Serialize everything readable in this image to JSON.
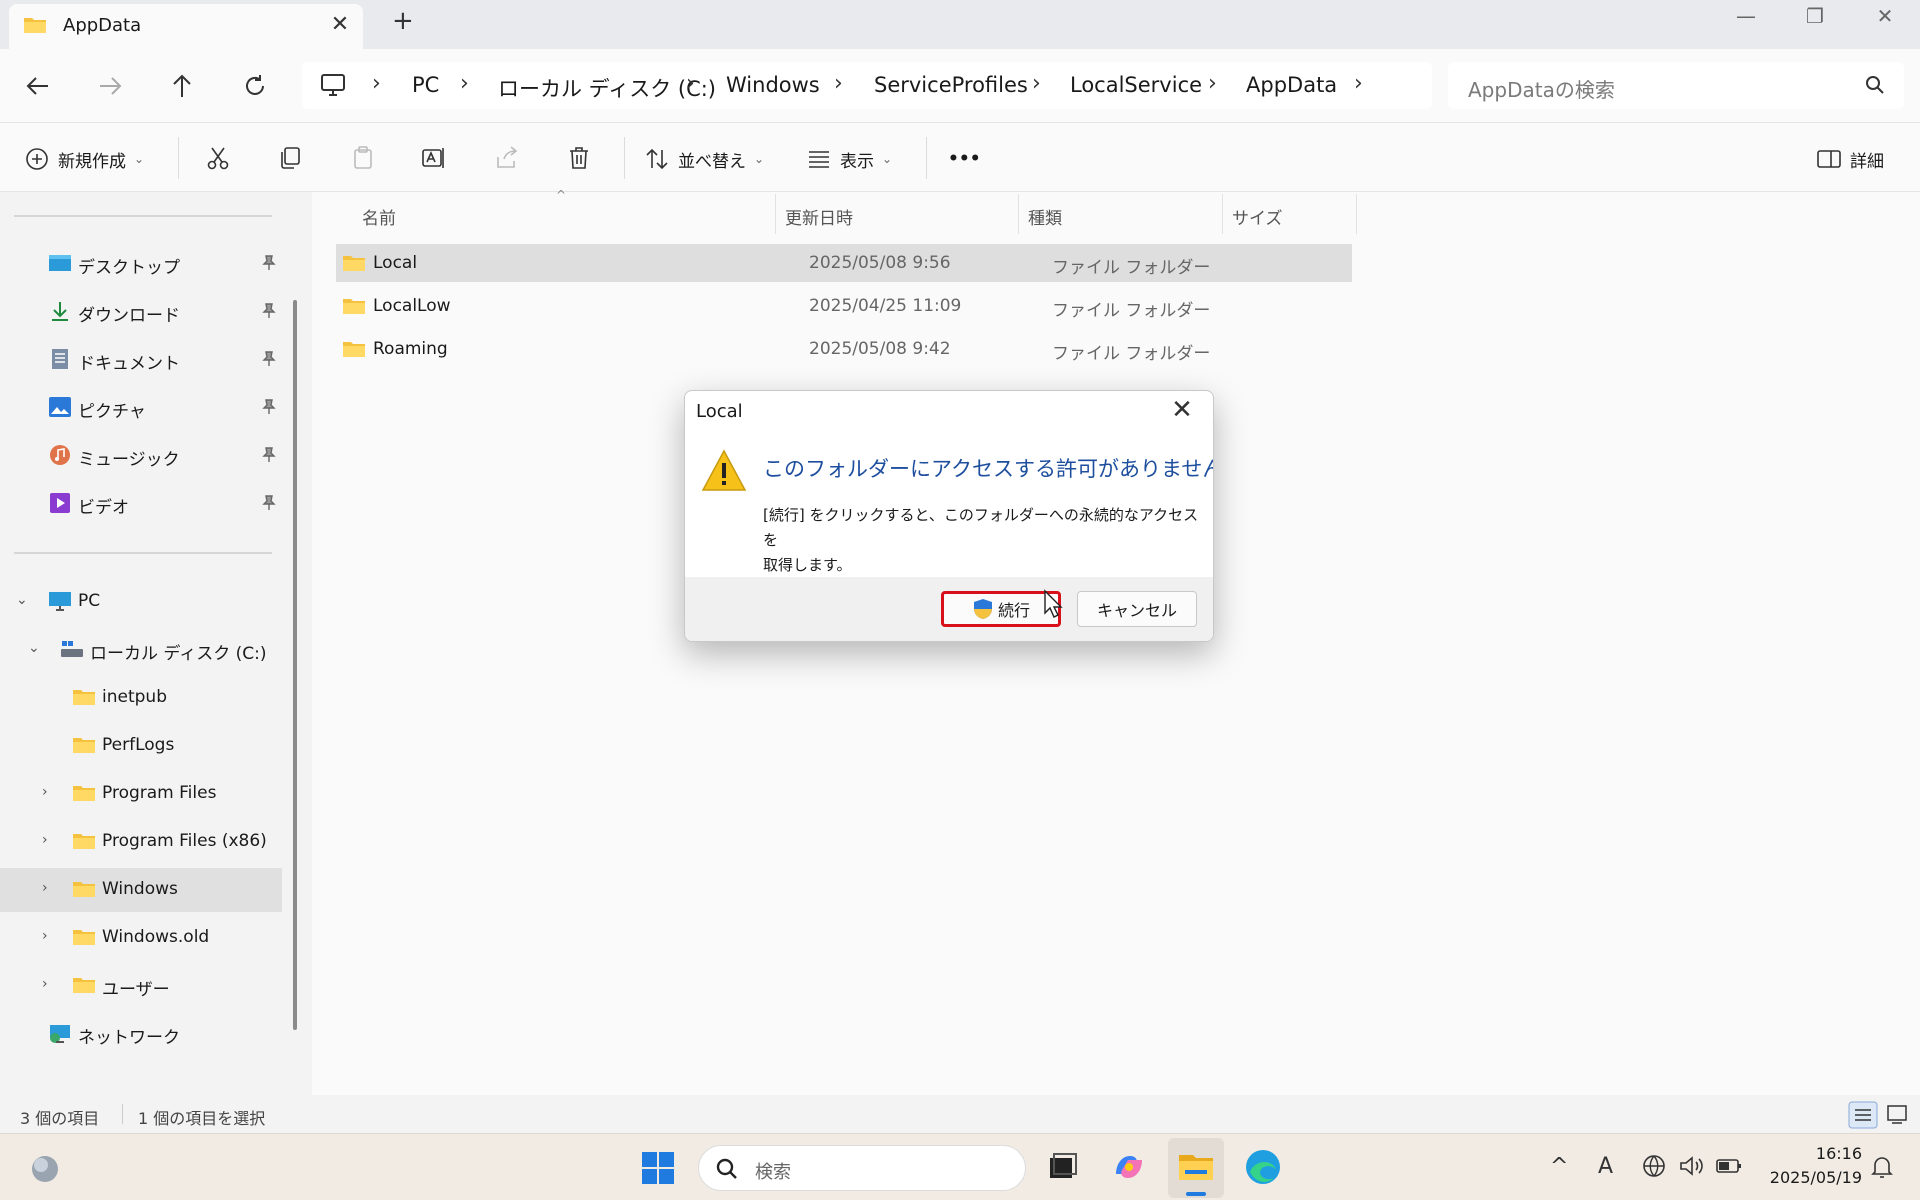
{
  "window": {
    "tab_title": "AppData",
    "new_tab": "+",
    "minimize": "—",
    "restore": "❐",
    "close": "✕",
    "tab_close": "✕"
  },
  "address": {
    "crumbs": [
      "PC",
      "ローカル ディスク (C:)",
      "Windows",
      "ServiceProfiles",
      "LocalService",
      "AppData"
    ],
    "search_placeholder": "AppDataの検索"
  },
  "toolbar": {
    "new_label": "新規作成",
    "sort_label": "並べ替え",
    "view_label": "表示",
    "more_label": "•••",
    "details_label": "詳細"
  },
  "sidebar": {
    "quick_access": [
      "デスクトップ",
      "ダウンロード",
      "ドキュメント",
      "ピクチャ",
      "ミュージック",
      "ビデオ"
    ],
    "pc_label": "PC",
    "drive_label": "ローカル ディスク (C:)",
    "folders": [
      "inetpub",
      "PerfLogs",
      "Program Files",
      "Program Files (x86)",
      "Windows",
      "Windows.old",
      "ユーザー"
    ],
    "network_label": "ネットワーク"
  },
  "columns": {
    "name": "名前",
    "modified": "更新日時",
    "type": "種類",
    "size": "サイズ"
  },
  "files": [
    {
      "name": "Local",
      "modified": "2025/05/08 9:56",
      "type": "ファイル フォルダー"
    },
    {
      "name": "LocalLow",
      "modified": "2025/04/25 11:09",
      "type": "ファイル フォルダー"
    },
    {
      "name": "Roaming",
      "modified": "2025/05/08 9:42",
      "type": "ファイル フォルダー"
    }
  ],
  "status": {
    "item_count": "3 個の項目",
    "selected": "1 個の項目を選択"
  },
  "dialog": {
    "title": "Local",
    "heading": "このフォルダーにアクセスする許可がありません。",
    "body_line1": "[続行] をクリックすると、このフォルダーへの永続的なアクセスを",
    "body_line2": "取得します。",
    "continue_label": "続行",
    "cancel_label": "キャンセル",
    "close": "✕"
  },
  "taskbar": {
    "search_placeholder": "検索",
    "time": "16:16",
    "date": "2025/05/19",
    "ime": "A"
  },
  "colors": {
    "selection": "#dedede",
    "dialog_heading": "#1e4e9e",
    "highlight_border": "#d8101c",
    "folder": "#f4c23f"
  }
}
